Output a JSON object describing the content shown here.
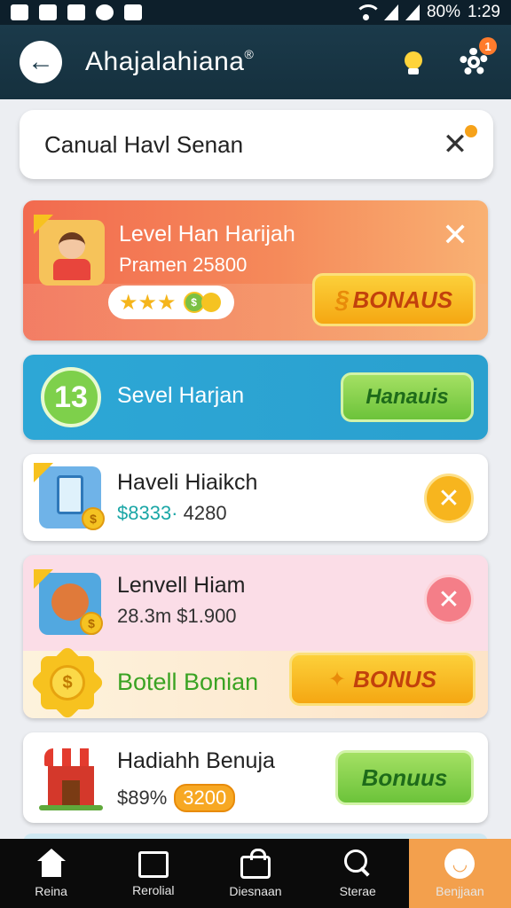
{
  "status_bar": {
    "battery": "80%",
    "time": "1:29"
  },
  "header": {
    "title": "Ahajalahiana",
    "title_mark": "®",
    "settings_badge": "1"
  },
  "search": {
    "value": "Canual Havl Senan"
  },
  "cards": [
    {
      "title": "Level Han Harijah",
      "subtitle": "Pramen 25800",
      "stars": "★★★",
      "button_label": "BONAUS"
    },
    {
      "badge": "13",
      "title": "Sevel Harjan",
      "button_label": "Hanauis"
    },
    {
      "title": "Haveli Hiaikch",
      "price_old": "$8333·",
      "price_new": "4280"
    },
    {
      "title": "Lenvell Hiam",
      "subtitle": "28.3m  $1.900",
      "promo_text": "Botell Bonian",
      "button_label": "BONUS"
    },
    {
      "title": "Hadiahh Benuja",
      "price_old": "$89%",
      "price_pill": "3200",
      "button_label": "Bonuus"
    }
  ],
  "nav": [
    {
      "label": "Reina",
      "icon": "home-icon"
    },
    {
      "label": "Rerolial",
      "icon": "folder-icon"
    },
    {
      "label": "Diesnaan",
      "icon": "bag-icon"
    },
    {
      "label": "Sterae",
      "icon": "search-icon"
    },
    {
      "label": "Benjjaan",
      "icon": "smile-icon"
    }
  ],
  "colors": {
    "header": "#1b3a4a",
    "accent_orange": "#f7a823",
    "accent_green": "#7ed04b",
    "nav_active": "#f3a04d"
  }
}
